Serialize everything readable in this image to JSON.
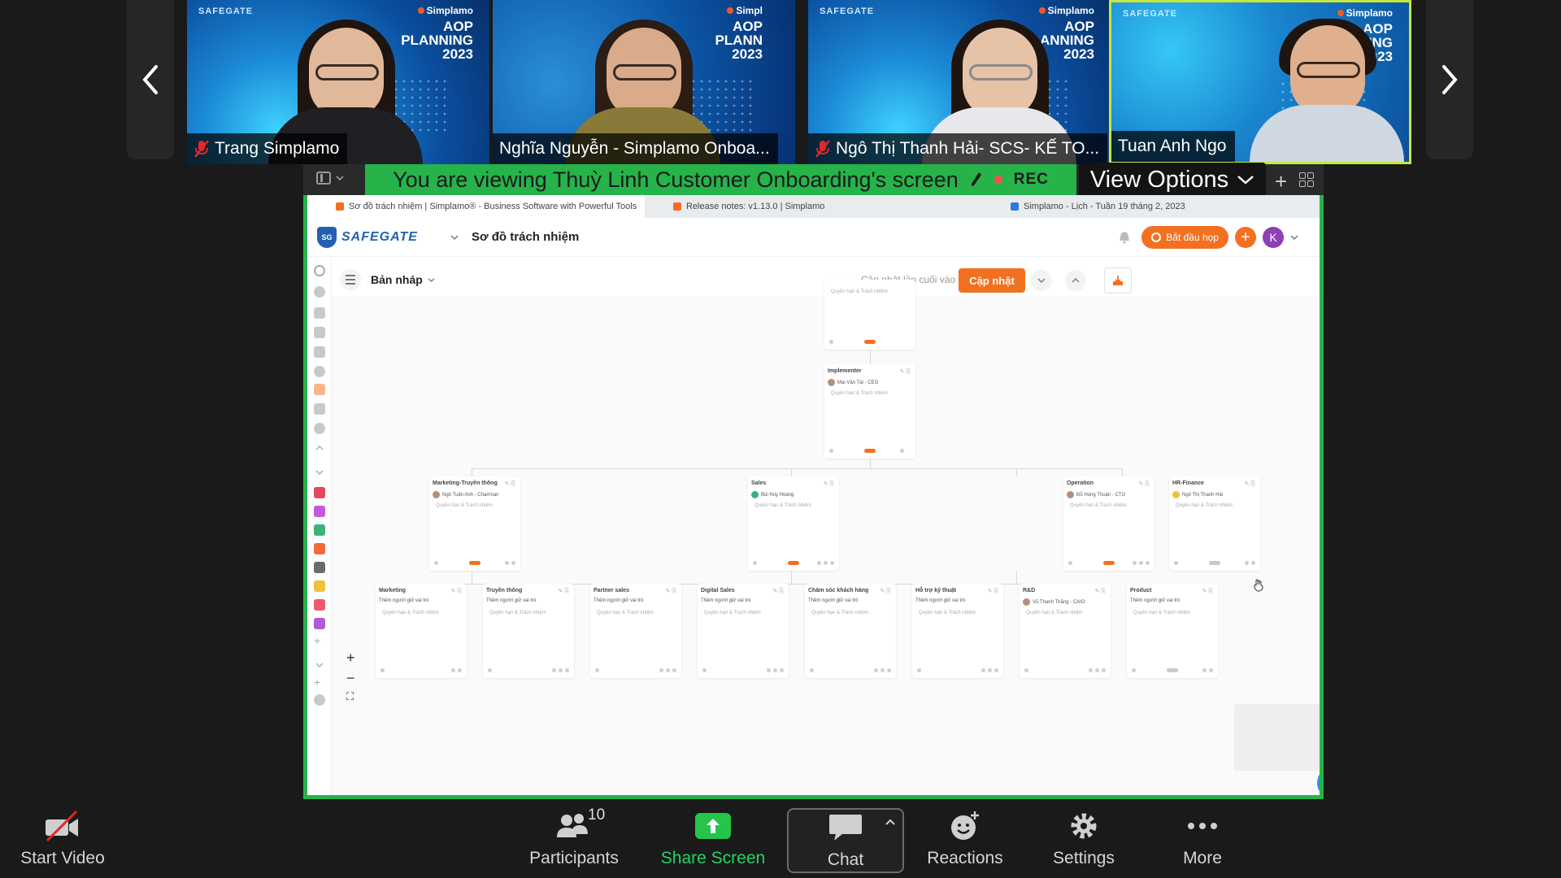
{
  "gallery": {
    "participants": [
      {
        "name": "Trang Simplamo",
        "muted": true,
        "logo_left": "SAFEGATE",
        "logo_right": "Simplamo",
        "banner": "AOP\nPLANNING\n2023"
      },
      {
        "name": "Nghĩa Nguyễn - Simplamo Onboa...",
        "muted": false,
        "logo_left": "",
        "logo_right": "Simpl",
        "banner": "AOP\nPLANN\n2023"
      },
      {
        "name": "Ngô Thị Thanh Hải- SCS- KẾ TO...",
        "muted": true,
        "logo_left": "SAFEGATE",
        "logo_right": "Simplamo",
        "banner": "AOP\nPLANNING\n2023"
      },
      {
        "name": "Tuan Anh Ngo",
        "muted": false,
        "logo_left": "SAFEGATE",
        "logo_right": "Simplamo",
        "banner": "AOP\nLANNING\n2023"
      }
    ]
  },
  "share": {
    "viewing_text": "You are viewing Thuỳ Linh Customer Onboarding's screen",
    "rec_label": "REC",
    "view_options_label": "View Options"
  },
  "browser": {
    "tabs": [
      "Sơ đồ trách nhiệm | Simplamo® - Business Software with Powerful Tools",
      "Release notes: v1.13.0 | Simplamo",
      "Simplamo - Lịch - Tuần 19 tháng 2, 2023"
    ]
  },
  "app": {
    "brand": "SAFEGATE",
    "brand_short": "SG",
    "page_title": "Sơ đồ trách nhiệm",
    "start_meeting_label": "Bắt đầu họp",
    "avatar_initial": "K",
    "draft_label": "Bản nháp",
    "last_update": "Cập nhật lần cuối vào 21.02.2023",
    "update_button": "Cập nhật"
  },
  "chart_nodes": {
    "top": {
      "title": "",
      "desc": "Quyền hạn & Trách nhiệm"
    },
    "implementer": {
      "title": "Implementer",
      "person": "Mai Văn Tài - CEO",
      "desc": "Quyền hạn & Trách nhiệm"
    },
    "level2": [
      {
        "title": "Marketing-Truyền thông",
        "person": "Ngô Tuấn Anh - Chairman",
        "desc": "Quyền hạn & Trách nhiệm"
      },
      {
        "title": "Sales",
        "person": "Bùi Huy Hoàng",
        "desc": "Quyền hạn & Trách nhiệm"
      },
      {
        "title": "Operation",
        "person": "Đỗ Hùng Thuận - CTO",
        "desc": "Quyền hạn & Trách nhiệm"
      },
      {
        "title": "HR-Finance",
        "person": "Ngô Thị Thanh Hải",
        "desc": "Quyền hạn & Trách nhiệm"
      }
    ],
    "level3": [
      {
        "title": "Marketing",
        "person": "Thêm người giữ vai trò",
        "desc": "Quyền hạn & Trách nhiệm"
      },
      {
        "title": "Truyền thông",
        "person": "Thêm người giữ vai trò",
        "desc": "Quyền hạn & Trách nhiệm"
      },
      {
        "title": "Partner sales",
        "person": "Thêm người giữ vai trò",
        "desc": "Quyền hạn & Trách nhiệm"
      },
      {
        "title": "Digital Sales",
        "person": "Thêm người giữ vai trò",
        "desc": "Quyền hạn & Trách nhiệm"
      },
      {
        "title": "Chăm sóc khách hàng",
        "person": "Thêm người giữ vai trò",
        "desc": "Quyền hạn & Trách nhiệm"
      },
      {
        "title": "Hỗ trợ kỹ thuật",
        "person": "Thêm người giữ vai trò",
        "desc": "Quyền hạn & Trách nhiệm"
      },
      {
        "title": "R&D",
        "person": "Vũ Thanh Thắng - CAIO",
        "desc": "Quyền hạn & Trách nhiệm"
      },
      {
        "title": "Product",
        "person": "Thêm người giữ vai trò",
        "desc": "Quyền hạn & Trách nhiệm"
      }
    ]
  },
  "controls": {
    "start_video": "Start Video",
    "participants": "Participants",
    "participants_count": "10",
    "share_screen": "Share Screen",
    "chat": "Chat",
    "reactions": "Reactions",
    "settings": "Settings",
    "more": "More"
  }
}
